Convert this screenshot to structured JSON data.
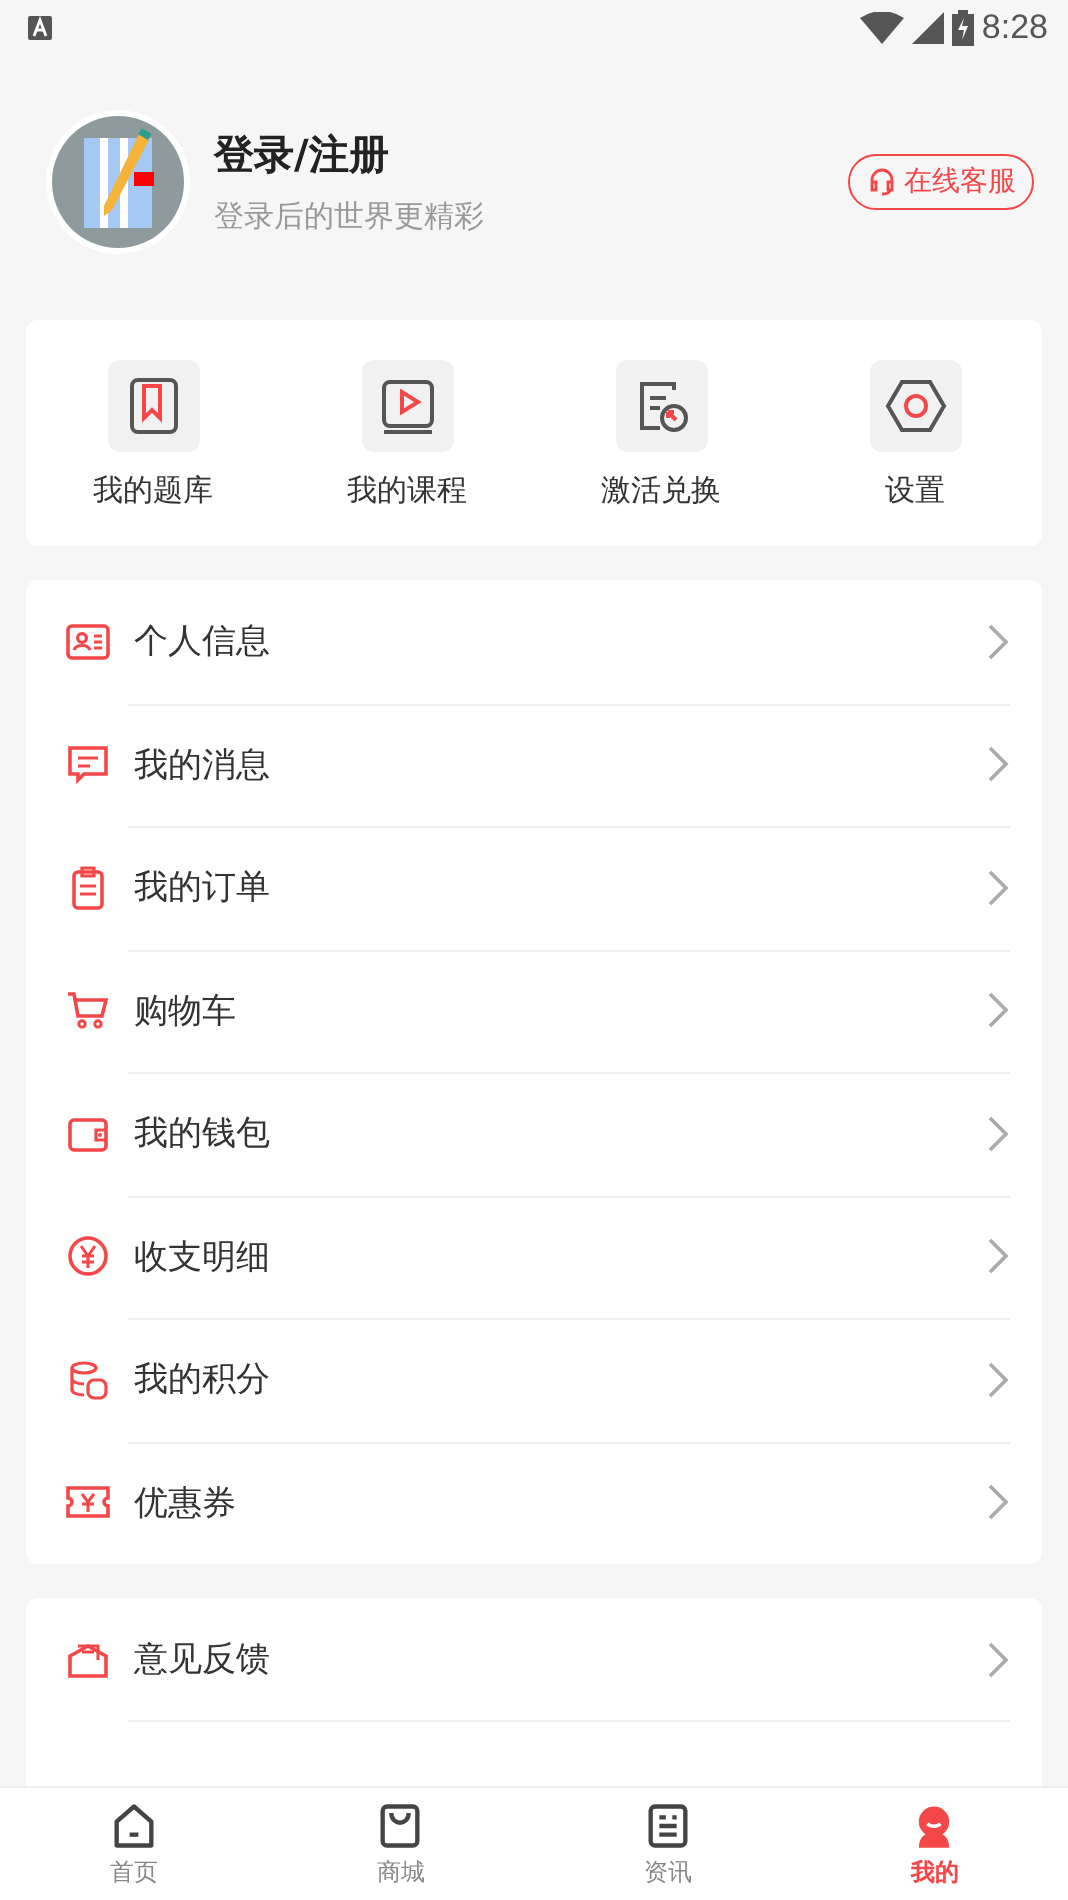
{
  "status_bar": {
    "time": "8:28"
  },
  "profile": {
    "title": "登录/注册",
    "subtitle": "登录后的世界更精彩",
    "service_button": "在线客服"
  },
  "quick_actions": [
    {
      "label": "我的题库"
    },
    {
      "label": "我的课程"
    },
    {
      "label": "激活兑换"
    },
    {
      "label": "设置"
    }
  ],
  "menu_groups": [
    {
      "items": [
        {
          "label": "个人信息"
        },
        {
          "label": "我的消息"
        },
        {
          "label": "我的订单"
        },
        {
          "label": "购物车"
        },
        {
          "label": "我的钱包"
        },
        {
          "label": "收支明细"
        },
        {
          "label": "我的积分"
        },
        {
          "label": "优惠券"
        }
      ]
    },
    {
      "items": [
        {
          "label": "意见反馈"
        }
      ]
    }
  ],
  "tabs": [
    {
      "label": "首页",
      "selected": false
    },
    {
      "label": "商城",
      "selected": false
    },
    {
      "label": "资讯",
      "selected": false
    },
    {
      "label": "我的",
      "selected": true
    }
  ]
}
